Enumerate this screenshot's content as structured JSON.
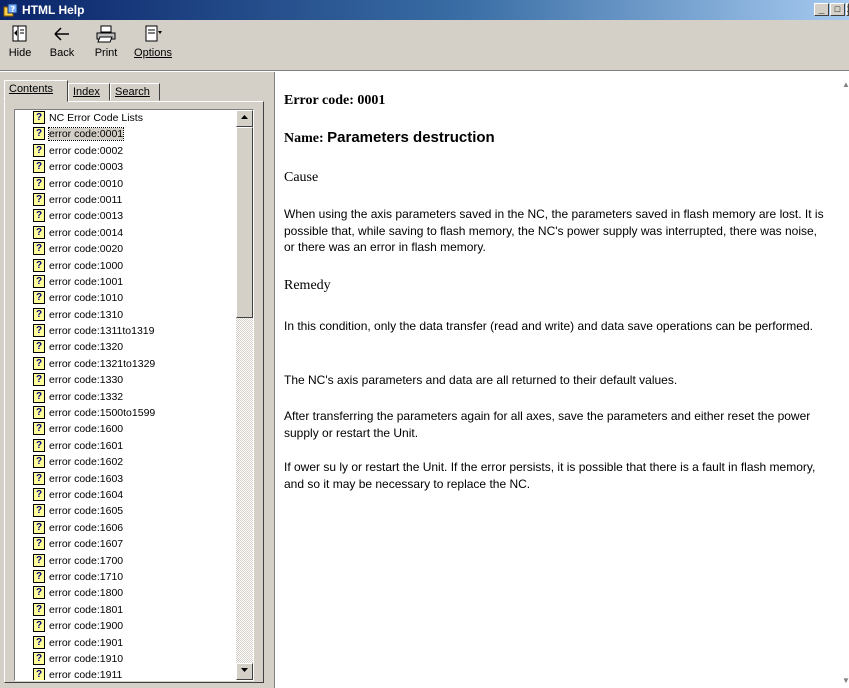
{
  "window": {
    "title": "HTML Help",
    "buttons": {
      "minimize": "_",
      "maximize": "□",
      "close": "x"
    }
  },
  "toolbar": {
    "hide": "Hide",
    "back": "Back",
    "print": "Print",
    "options": "Options"
  },
  "tabs": {
    "contents": "Contents",
    "index": "Index",
    "search": "Search"
  },
  "tree": {
    "items": [
      "NC Error Code Lists",
      "error code:0001",
      "error code:0002",
      "error code:0003",
      "error code:0010",
      "error code:0011",
      "error code:0013",
      "error code:0014",
      "error code:0020",
      "error code:1000",
      "error code:1001",
      "error code:1010",
      "error code:1310",
      "error code:1311to1319",
      "error code:1320",
      "error code:1321to1329",
      "error code:1330",
      "error code:1332",
      "error code:1500to1599",
      "error code:1600",
      "error code:1601",
      "error code:1602",
      "error code:1603",
      "error code:1604",
      "error code:1605",
      "error code:1606",
      "error code:1607",
      "error code:1700",
      "error code:1710",
      "error code:1800",
      "error code:1801",
      "error code:1900",
      "error code:1901",
      "error code:1910",
      "error code:1911"
    ],
    "selected_index": 1
  },
  "article": {
    "code_line": "Error code: 0001",
    "name_label": "Name: ",
    "name_value": "Parameters destruction",
    "cause_heading": "Cause",
    "cause_text": "When using the axis parameters saved in the NC, the parameters saved in flash memory are lost. It is possible that, while saving to flash memory, the NC's power supply was interrupted, there was noise, or there was an error in flash memory.",
    "remedy_heading": "Remedy",
    "remedy_1": "In this condition, only the data transfer (read and write) and data save operations can be performed.",
    "remedy_2": "The NC's axis parameters and data are all returned to their default values.",
    "remedy_3": "After transferring the parameters again for all axes, save the parameters and either reset the power supply or restart the Unit.",
    "remedy_4": "If ower su ly or restart the Unit. If the error persists, it is possible that there is a fault in flash memory, and so it may be necessary to replace the NC."
  }
}
